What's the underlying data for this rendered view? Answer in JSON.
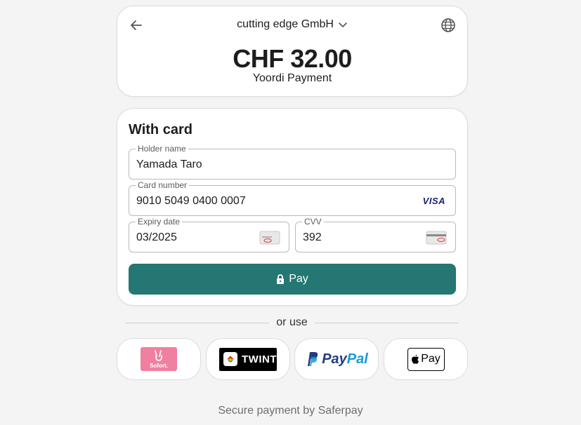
{
  "header": {
    "merchant": "cutting edge GmbH",
    "amount": "CHF 32.00",
    "description": "Yoordi Payment"
  },
  "form": {
    "title": "With card",
    "holder": {
      "label": "Holder name",
      "value": "Yamada Taro"
    },
    "card_number": {
      "label": "Card number",
      "value": "9010 5049 0400 0007",
      "brand": "VISA"
    },
    "expiry": {
      "label": "Expiry date",
      "value": "03/2025"
    },
    "cvv": {
      "label": "CVV",
      "value": "392"
    },
    "pay_label": "Pay"
  },
  "alternatives": {
    "divider_text": "or use",
    "methods": [
      {
        "name": "Sofort",
        "logo_text": "Sofort."
      },
      {
        "name": "TWINT",
        "logo_text": "TWINT"
      },
      {
        "name": "PayPal",
        "logo_text_1": "Pay",
        "logo_text_2": "Pal"
      },
      {
        "name": "Apple Pay",
        "logo_text": "Pay"
      }
    ]
  },
  "footer": "Secure payment by Saferpay",
  "colors": {
    "pay_button": "#247772",
    "background": "#f4f4f4",
    "sofort": "#ef809f",
    "paypal_dark": "#253b80",
    "paypal_light": "#179bd7"
  },
  "icons": [
    "arrow-left-icon",
    "chevron-down-icon",
    "globe-icon",
    "lock-icon",
    "card-expiry-icon",
    "card-cvv-icon"
  ]
}
